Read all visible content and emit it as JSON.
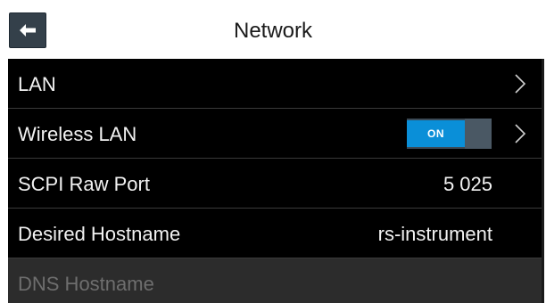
{
  "header": {
    "title": "Network",
    "back_icon": "arrow-left-icon"
  },
  "rows": [
    {
      "label": "LAN",
      "value": "",
      "has_chevron": true
    },
    {
      "label": "Wireless LAN",
      "toggle_label": "ON",
      "toggle_state": true,
      "has_chevron": true
    },
    {
      "label": "SCPI Raw Port",
      "value": "5 025"
    },
    {
      "label": "Desired Hostname",
      "value": "rs-instrument"
    },
    {
      "label": "DNS Hostname",
      "value": "",
      "disabled": true
    }
  ],
  "colors": {
    "toggle_on": "#0a8fd8",
    "row_background": "#000000",
    "disabled_row_background": "#2c2c2c",
    "back_button": "#34404a"
  }
}
